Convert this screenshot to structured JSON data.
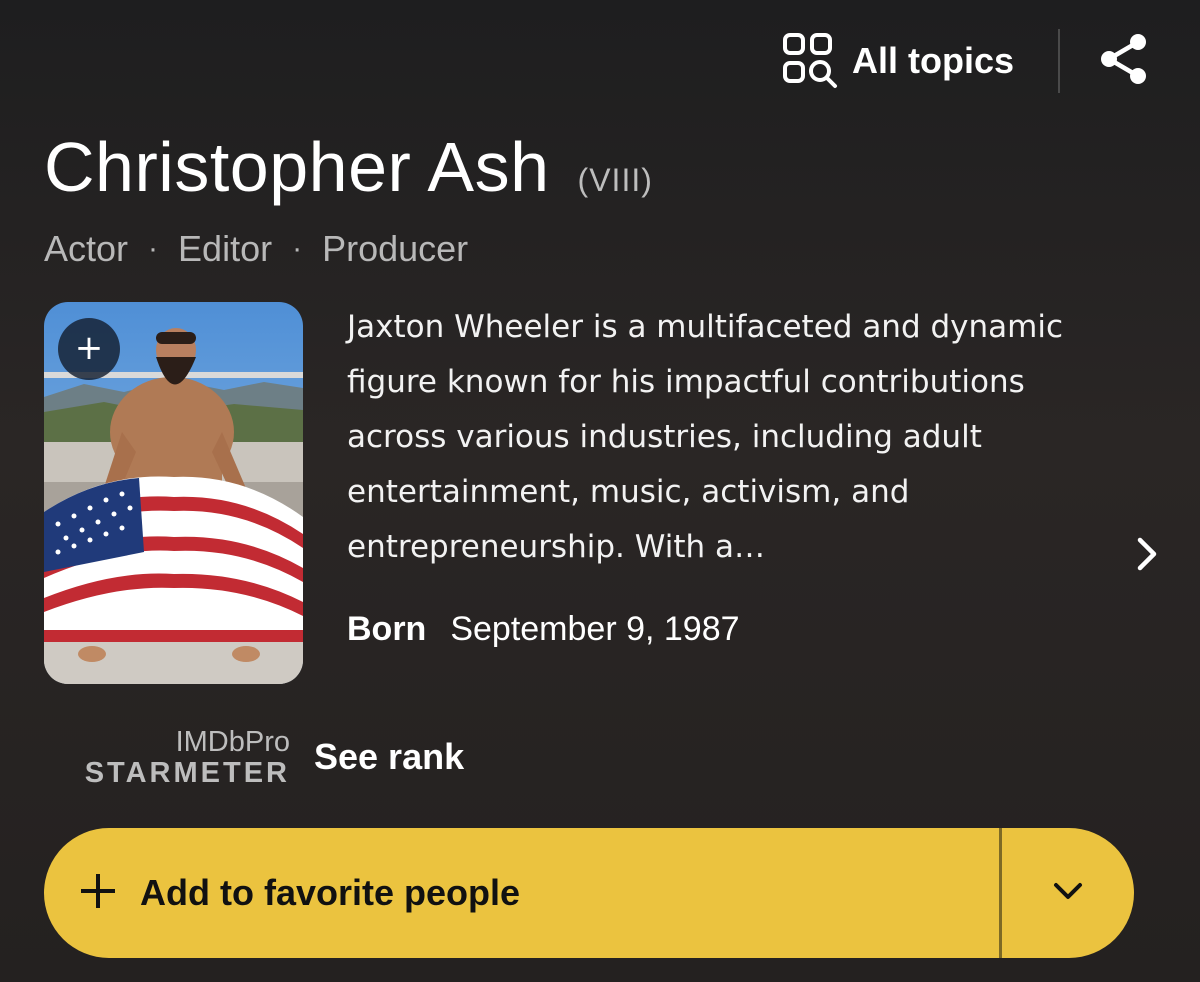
{
  "header": {
    "all_topics_label": "All topics",
    "all_topics_icon": "grid-search-icon",
    "share_icon": "share-icon"
  },
  "person": {
    "name": "Christopher Ash",
    "suffix": "(VIII)",
    "professions": [
      "Actor",
      "Editor",
      "Producer"
    ],
    "photo": {
      "add_icon": "+",
      "description_icon": "person-photo"
    },
    "bio": "Jaxton Wheeler is a multifaceted and dynamic figure known for his impactful contributions across various industries, including adult entertainment, music, activism, and entrepreneurship. With a…",
    "born_label": "Born",
    "born_value": "September 9, 1987"
  },
  "starmeter": {
    "top_label": "IMDbPro",
    "bottom_label": "STARMETER",
    "action_label": "See rank"
  },
  "favorite": {
    "label": "Add to favorite people",
    "plus_icon": "plus-icon",
    "dropdown_icon": "chevron-down-icon"
  },
  "colors": {
    "background": "#242120",
    "accent": "#ebc33f",
    "muted_text": "#b8b8b8"
  }
}
